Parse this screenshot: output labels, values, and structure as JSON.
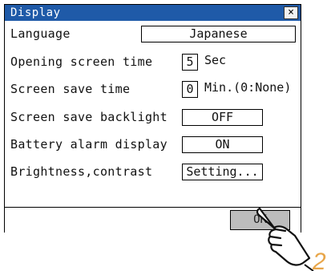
{
  "window": {
    "title": "Display",
    "close_symbol": "×"
  },
  "rows": [
    {
      "label": "Language",
      "value": "Japanese"
    },
    {
      "label": "Opening screen time",
      "value": "5",
      "unit": "Sec"
    },
    {
      "label": "Screen save time",
      "value": "0",
      "unit": "Min.(0:None)"
    },
    {
      "label": "Screen save backlight",
      "value": "OFF"
    },
    {
      "label": "Battery alarm display",
      "value": "ON"
    },
    {
      "label": "Brightness,contrast",
      "value": "Setting..."
    }
  ],
  "footer": {
    "ok_label": "OK"
  },
  "annotation": {
    "step_number": "2"
  },
  "colors": {
    "title_bar": "#1f5aa8",
    "ok_button": "#bdbdbd",
    "annotation": "#e8a64a"
  },
  "icons": {
    "pointer": "pointing-hand-icon",
    "close": "close-icon"
  }
}
